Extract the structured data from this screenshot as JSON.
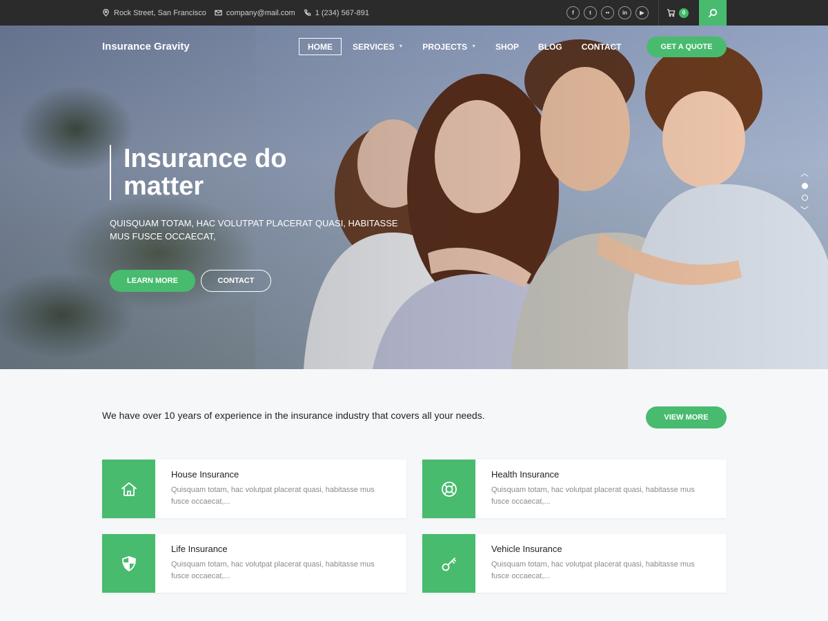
{
  "topbar": {
    "address": "Rock Street, San Francisco",
    "email": "company@mail.com",
    "phone": "1 (234) 567-891",
    "socials": [
      {
        "icon": "facebook-icon",
        "glyph": "f"
      },
      {
        "icon": "twitter-icon",
        "glyph": "t"
      },
      {
        "icon": "flickr-icon",
        "glyph": "••"
      },
      {
        "icon": "linkedin-icon",
        "glyph": "in"
      },
      {
        "icon": "youtube-icon",
        "glyph": "▶"
      }
    ],
    "cart_count": "0"
  },
  "header": {
    "brand": "Insurance Gravity",
    "nav": [
      {
        "label": "HOME",
        "active": true
      },
      {
        "label": "SERVICES",
        "dropdown": true
      },
      {
        "label": "PROJECTS",
        "dropdown": true
      },
      {
        "label": "SHOP"
      },
      {
        "label": "BLOG"
      },
      {
        "label": "CONTACT"
      }
    ],
    "quote_label": "GET A QUOTE"
  },
  "hero": {
    "title": "Insurance do matter",
    "subtitle": "QUISQUAM TOTAM, HAC VOLUTPAT PLACERAT QUASI, HABITASSE MUS FUSCE OCCAECAT,",
    "learn_more_label": "LEARN MORE",
    "contact_label": "CONTACT"
  },
  "intro": {
    "text": "We have over 10 years of experience in the insurance industry that covers all your needs.",
    "view_more_label": "VIEW MORE"
  },
  "services": [
    {
      "title": "House Insurance",
      "icon": "house-icon",
      "desc": "Quisquam totam, hac volutpat placerat quasi, habitasse mus fusce occaecat,..."
    },
    {
      "title": "Health Insurance",
      "icon": "lifebuoy-icon",
      "desc": "Quisquam totam, hac volutpat placerat quasi, habitasse mus fusce occaecat,..."
    },
    {
      "title": "Life Insurance",
      "icon": "shield-icon",
      "desc": "Quisquam totam, hac volutpat placerat quasi, habitasse mus fusce occaecat,..."
    },
    {
      "title": "Vehicle Insurance",
      "icon": "key-icon",
      "desc": "Quisquam totam, hac volutpat placerat quasi, habitasse mus fusce occaecat,..."
    }
  ],
  "colors": {
    "accent": "#48bb6f",
    "topbar": "#2b2b2b"
  }
}
